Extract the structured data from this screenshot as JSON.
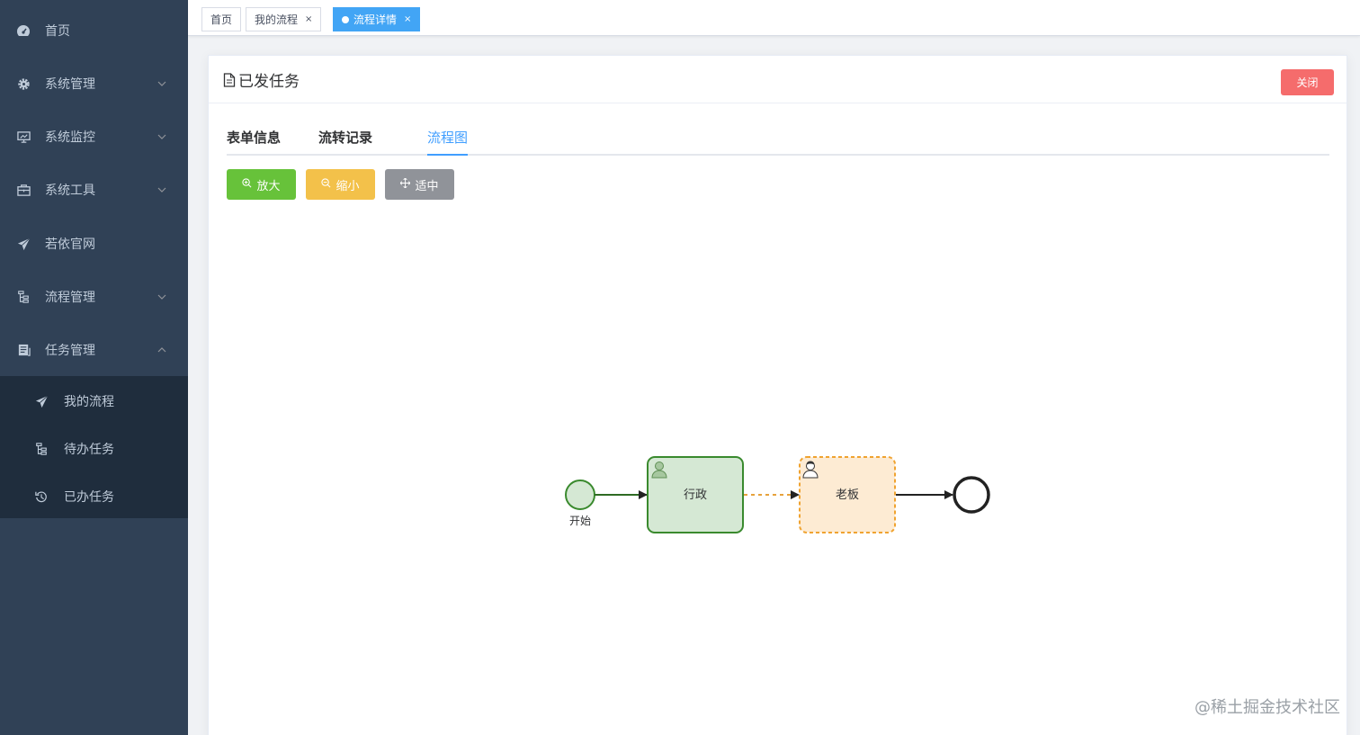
{
  "sidebar": {
    "items": [
      {
        "label": "首页",
        "icon": "dashboard-icon",
        "expandable": false
      },
      {
        "label": "系统管理",
        "icon": "gear-icon",
        "expandable": true
      },
      {
        "label": "系统监控",
        "icon": "monitor-icon",
        "expandable": true
      },
      {
        "label": "系统工具",
        "icon": "toolbox-icon",
        "expandable": true
      },
      {
        "label": "若依官网",
        "icon": "paper-plane-icon",
        "expandable": false
      },
      {
        "label": "流程管理",
        "icon": "tree-icon",
        "expandable": true
      },
      {
        "label": "任务管理",
        "icon": "document-icon",
        "expandable": true,
        "expanded": true
      }
    ],
    "submenu": [
      {
        "label": "我的流程",
        "icon": "paper-plane-icon"
      },
      {
        "label": "待办任务",
        "icon": "tree-icon"
      },
      {
        "label": "已办任务",
        "icon": "history-icon"
      }
    ]
  },
  "tags": [
    {
      "label": "首页",
      "active": false,
      "closable": false
    },
    {
      "label": "我的流程",
      "active": false,
      "closable": true
    },
    {
      "label": "流程详情",
      "active": true,
      "closable": true
    }
  ],
  "tag_close": "×",
  "card": {
    "title": "已发任务",
    "close_label": "关闭"
  },
  "tabs": [
    {
      "label": "表单信息",
      "active": false
    },
    {
      "label": "流转记录",
      "active": false
    },
    {
      "label": "流程图",
      "active": true
    }
  ],
  "toolbar": {
    "zoom_in": "放大",
    "zoom_out": "缩小",
    "fit": "适中"
  },
  "diagram": {
    "start_label": "开始",
    "task1_label": "行政",
    "task2_label": "老板"
  },
  "watermark": "@稀土掘金技术社区",
  "colors": {
    "sidebar_bg": "#304156",
    "submenu_bg": "#1f2d3d",
    "active_tag": "#42a5f5",
    "danger": "#f56c6c",
    "success": "#67c23a",
    "warning": "#e6a23c",
    "info": "#909399",
    "primary": "#409eff"
  }
}
